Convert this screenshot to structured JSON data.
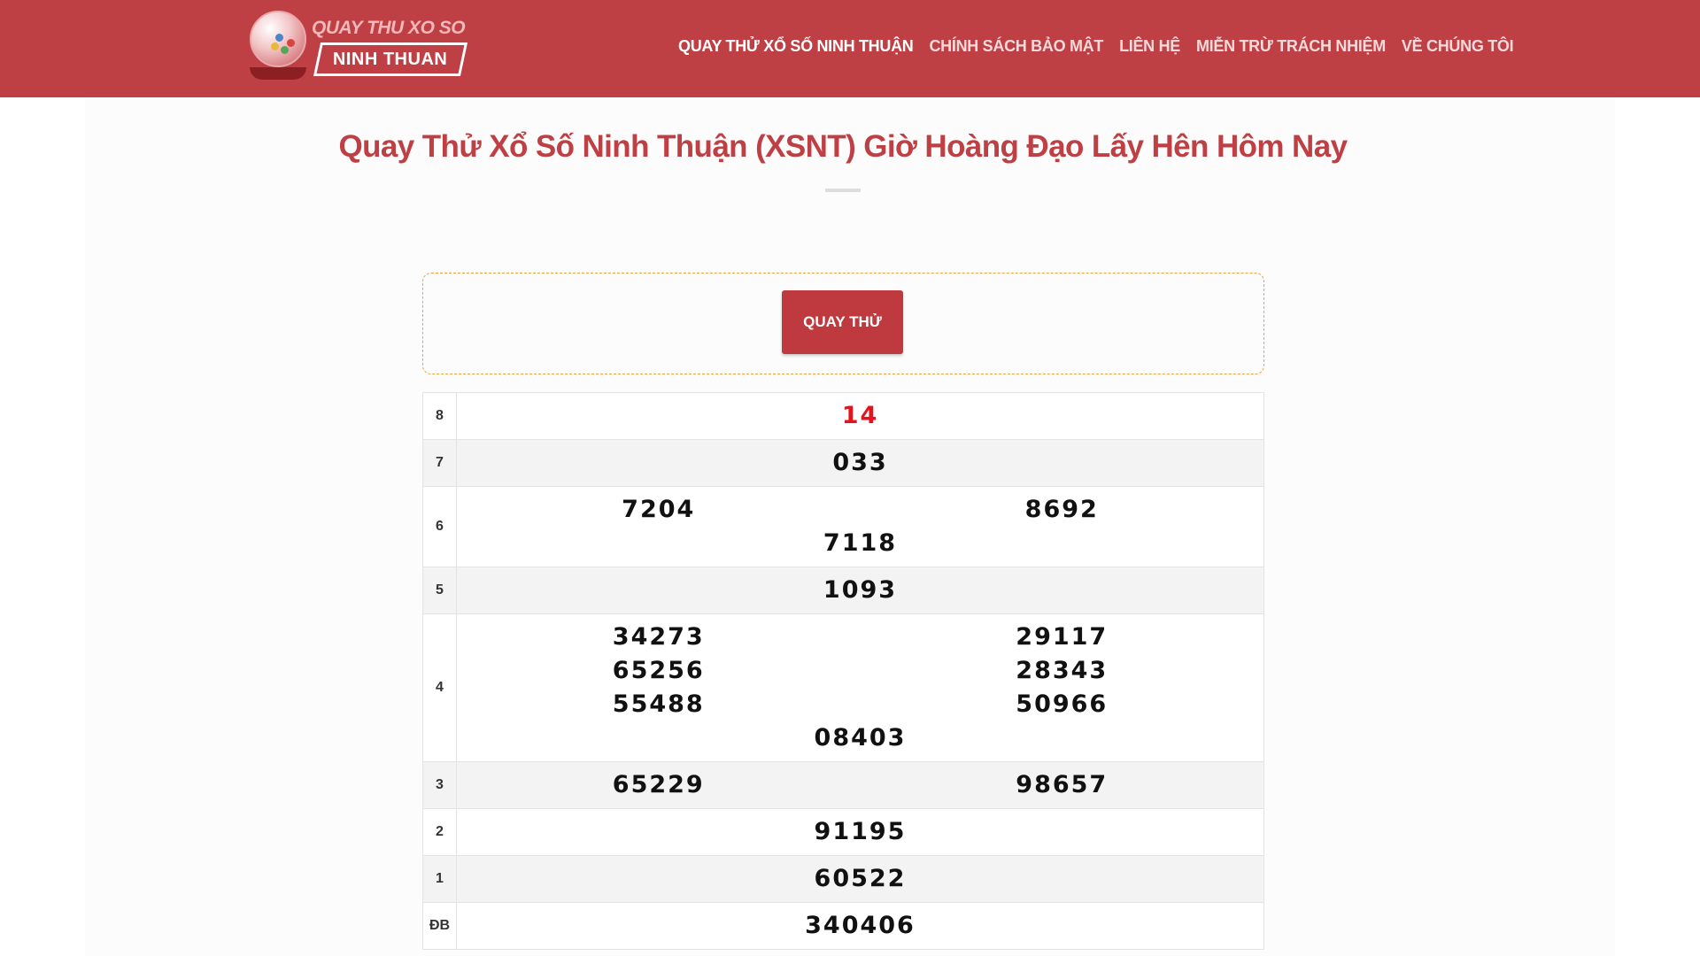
{
  "header": {
    "logo_top_text": "QUAY THU XO SO",
    "logo_main_text": "NINH THUAN",
    "nav": [
      {
        "label": "QUAY THỬ XỔ SỐ NINH THUẬN"
      },
      {
        "label": "CHÍNH SÁCH BẢO MẬT"
      },
      {
        "label": "LIÊN HỆ"
      },
      {
        "label": "MIỄN TRỪ TRÁCH NHIỆM"
      },
      {
        "label": "VỀ CHÚNG TÔI"
      }
    ]
  },
  "main": {
    "title": "Quay Thử Xổ Số Ninh Thuận (XSNT) Giờ Hoàng Đạo Lấy Hên Hôm Nay",
    "spin_button": "QUAY THỬ"
  },
  "results": [
    {
      "prize": "8",
      "numbers": [
        "14"
      ],
      "highlight": true
    },
    {
      "prize": "7",
      "numbers": [
        "033"
      ]
    },
    {
      "prize": "6",
      "numbers": [
        "7204",
        "8692",
        "7118"
      ]
    },
    {
      "prize": "5",
      "numbers": [
        "1093"
      ]
    },
    {
      "prize": "4",
      "numbers": [
        "34273",
        "29117",
        "65256",
        "28343",
        "55488",
        "50966",
        "08403"
      ]
    },
    {
      "prize": "3",
      "numbers": [
        "65229",
        "98657"
      ]
    },
    {
      "prize": "2",
      "numbers": [
        "91195"
      ]
    },
    {
      "prize": "1",
      "numbers": [
        "60522"
      ]
    },
    {
      "prize": "ĐB",
      "numbers": [
        "340406"
      ]
    }
  ],
  "colors": {
    "brand_red": "#bf4044",
    "highlight_red": "#e8121c",
    "dashed_border": "#f1a23d"
  }
}
